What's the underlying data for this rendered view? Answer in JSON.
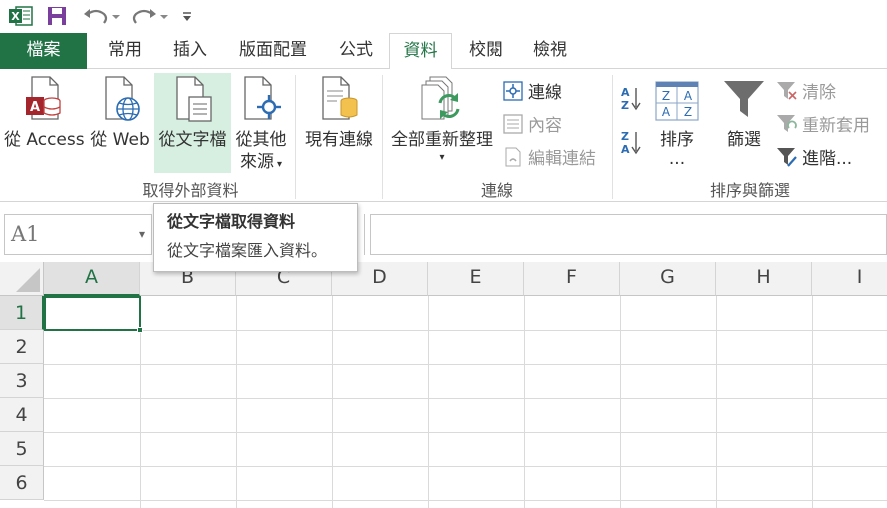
{
  "qat": {
    "icons": [
      "excel-logo-icon",
      "save-icon",
      "undo-icon",
      "redo-icon",
      "customize-icon"
    ],
    "excel_letter": "X"
  },
  "tabs": [
    {
      "label": "檔案"
    },
    {
      "label": "常用"
    },
    {
      "label": "插入"
    },
    {
      "label": "版面配置"
    },
    {
      "label": "公式"
    },
    {
      "label": "資料"
    },
    {
      "label": "校閱"
    },
    {
      "label": "檢視"
    }
  ],
  "ribbon": {
    "external": {
      "access": "從 Access",
      "web": "從 Web",
      "text": "從文字檔",
      "other_line1": "從其他",
      "other_line2": "來源",
      "existing": "現有連線",
      "group": "取得外部資料"
    },
    "connections": {
      "refresh": "全部重新整理",
      "links": "連線",
      "properties": "內容",
      "edit_links": "編輯連結",
      "group": "連線"
    },
    "sort_filter": {
      "sort": "排序",
      "sort_more": "...",
      "filter": "篩選",
      "clear": "清除",
      "reapply": "重新套用",
      "advanced": "進階...",
      "group": "排序與篩選",
      "az": "A Z",
      "za": "Z A"
    }
  },
  "tooltip": {
    "title": "從文字檔取得資料",
    "desc": "從文字檔案匯入資料。"
  },
  "namebox": {
    "value": "A1"
  },
  "grid": {
    "columns": [
      "A",
      "B",
      "C",
      "D",
      "E",
      "F",
      "G",
      "H",
      "I"
    ],
    "rows": [
      "1",
      "2",
      "3",
      "4",
      "5",
      "6"
    ],
    "selected_cell": "A1"
  },
  "colors": {
    "accent": "#217346",
    "hover": "#d6efe0"
  }
}
